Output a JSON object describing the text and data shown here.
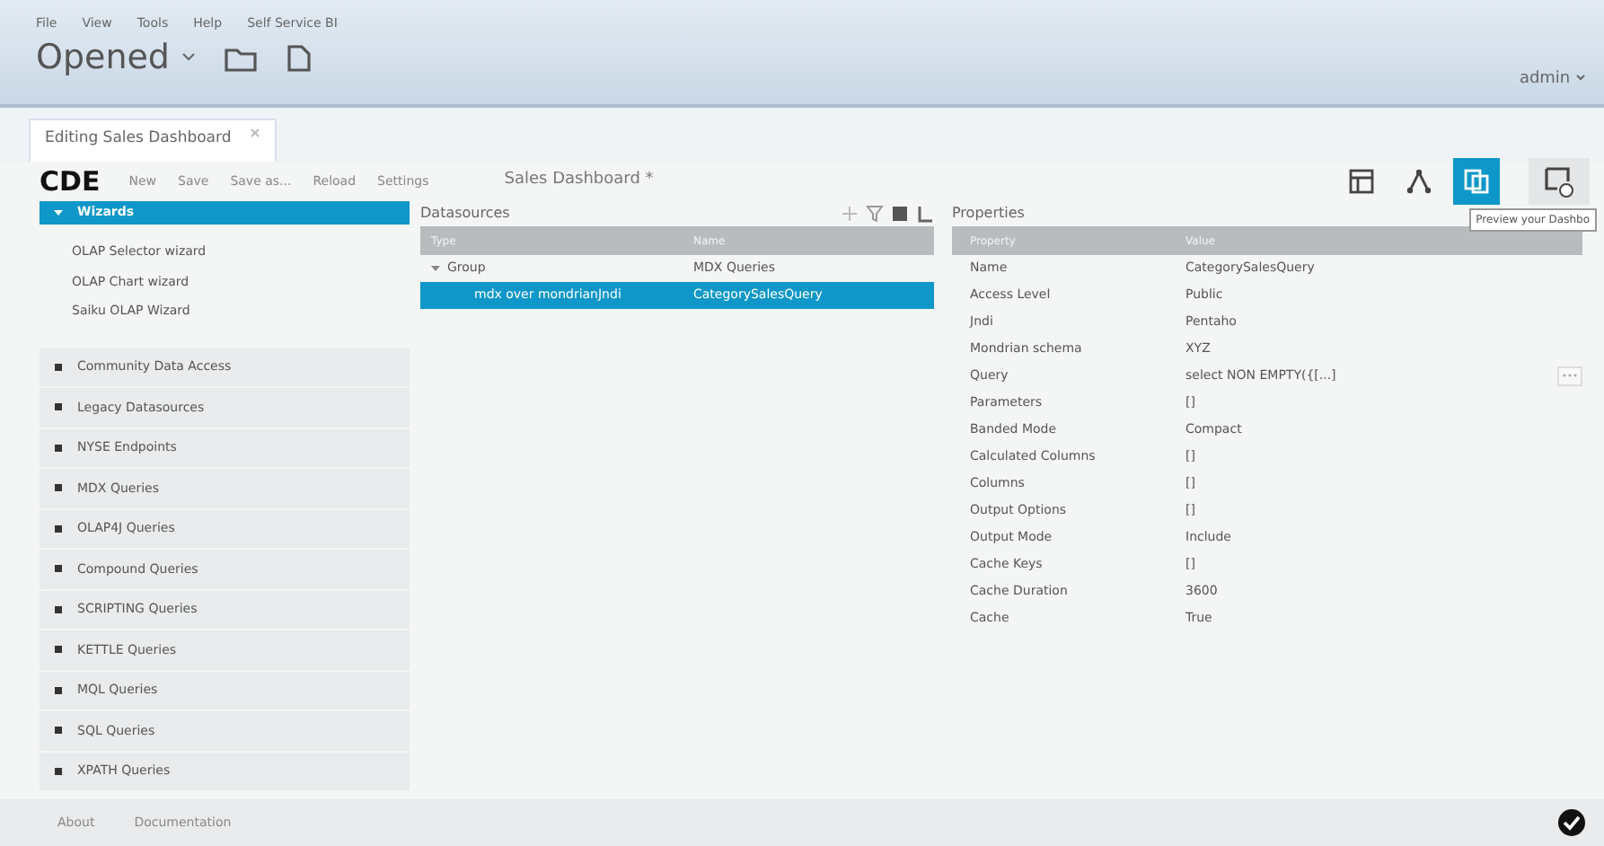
{
  "menu": [
    "File",
    "View",
    "Tools",
    "Help",
    "Self Service BI"
  ],
  "perspective": {
    "label": "Opened"
  },
  "user": {
    "label": "admin"
  },
  "tabs": [
    {
      "label": "Editing Sales Dashboard",
      "selected": true
    }
  ],
  "toolbar": {
    "logo": "CDE",
    "actions": [
      "New",
      "Save",
      "Save as...",
      "Reload",
      "Settings"
    ],
    "title": "Sales Dashboard *",
    "views": [
      {
        "kind": "layout",
        "selected": false
      },
      {
        "kind": "components",
        "selected": false
      },
      {
        "kind": "datasources",
        "selected": true
      }
    ],
    "tooltip": "Preview your Dashbo"
  },
  "sidebar": {
    "groups": [
      {
        "label": "Wizards",
        "expanded": true,
        "children": [
          "OLAP Selector wizard",
          "OLAP Chart wizard",
          "Saiku OLAP Wizard"
        ]
      },
      {
        "label": "Community Data Access",
        "expanded": false
      },
      {
        "label": "Legacy Datasources",
        "expanded": false
      },
      {
        "label": "NYSE Endpoints",
        "expanded": false
      },
      {
        "label": "MDX Queries",
        "expanded": false
      },
      {
        "label": "OLAP4J Queries",
        "expanded": false
      },
      {
        "label": "Compound Queries",
        "expanded": false
      },
      {
        "label": "SCRIPTING Queries",
        "expanded": false
      },
      {
        "label": "KETTLE Queries",
        "expanded": false
      },
      {
        "label": "MQL Queries",
        "expanded": false
      },
      {
        "label": "SQL Queries",
        "expanded": false
      },
      {
        "label": "XPATH Queries",
        "expanded": false
      }
    ]
  },
  "datasources": {
    "title": "Datasources",
    "columns": [
      "Type",
      "Name"
    ],
    "rows": [
      {
        "kind": "group",
        "type": "Group",
        "name": "MDX Queries",
        "expanded": true,
        "selected": false
      },
      {
        "kind": "item",
        "type": "mdx over mondrianJndi",
        "name": "CategorySalesQuery",
        "selected": true
      }
    ]
  },
  "properties": {
    "title": "Properties",
    "columns": [
      "Property",
      "Value"
    ],
    "rows": [
      {
        "kind": "text",
        "property": "Name",
        "value": "CategorySalesQuery"
      },
      {
        "kind": "text",
        "property": "Access Level",
        "value": "Public"
      },
      {
        "kind": "text",
        "property": "Jndi",
        "value": "Pentaho"
      },
      {
        "kind": "text",
        "property": "Mondrian schema",
        "value": "XYZ"
      },
      {
        "kind": "editor",
        "property": "Query",
        "value": "select NON EMPTY({[...]"
      },
      {
        "kind": "text",
        "property": "Parameters",
        "value": "[]"
      },
      {
        "kind": "text",
        "property": "Banded Mode",
        "value": "Compact"
      },
      {
        "kind": "text",
        "property": "Calculated Columns",
        "value": "[]"
      },
      {
        "kind": "text",
        "property": "Columns",
        "value": "[]"
      },
      {
        "kind": "text",
        "property": "Output Options",
        "value": "[]"
      },
      {
        "kind": "text",
        "property": "Output Mode",
        "value": "Include"
      },
      {
        "kind": "text",
        "property": "Cache Keys",
        "value": "[]"
      },
      {
        "kind": "text",
        "property": "Cache Duration",
        "value": "3600"
      },
      {
        "kind": "text",
        "property": "Cache",
        "value": "True"
      }
    ]
  },
  "footer": {
    "links": [
      "About",
      "Documentation"
    ]
  }
}
